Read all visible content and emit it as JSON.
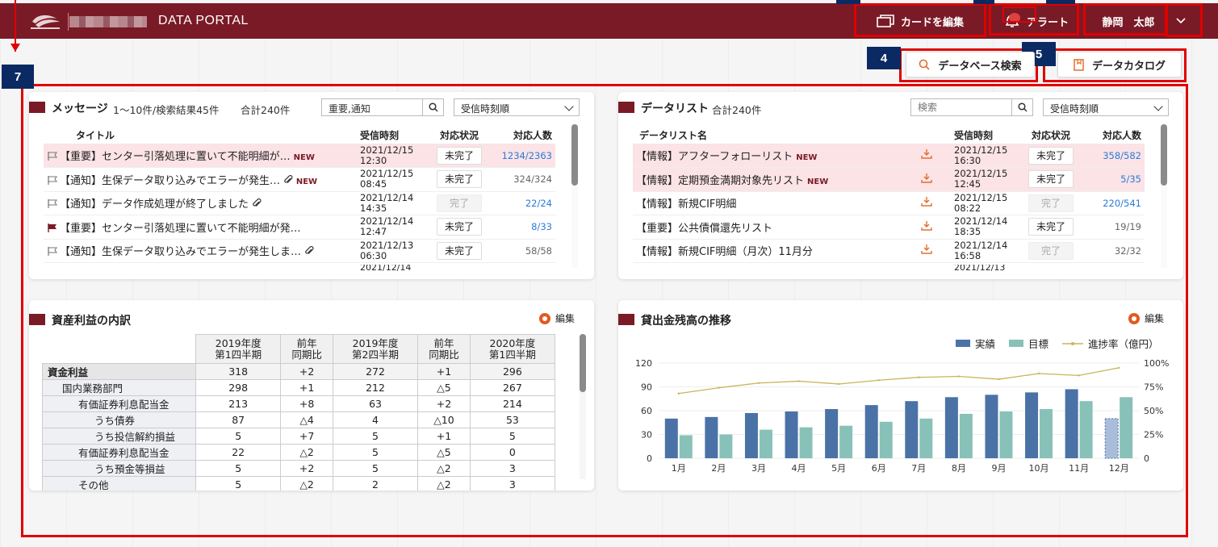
{
  "app": {
    "title": "DATA PORTAL"
  },
  "header": {
    "edit_cards_label": "カードを編集",
    "alert_label": "アラート",
    "user_name": "静岡　太郎"
  },
  "annotations": {
    "a4": "4",
    "a5": "5",
    "a7": "7"
  },
  "actions": {
    "db_search_label": "データベース検索",
    "data_catalog_label": "データカタログ"
  },
  "messages": {
    "title": "メッセージ",
    "summary": "1～10件/検索結果45件",
    "total": "合計240件",
    "search_value": "重要,通知",
    "sort_label": "受信時刻順",
    "columns": [
      "タイトル",
      "受信時刻",
      "対応状況",
      "対応人数"
    ],
    "rows": [
      {
        "flag": "outline",
        "title": "【重要】センター引落処理に置いて不能明細が…",
        "attach": false,
        "new": "NEW",
        "date": "2021/12/15",
        "time": "12:30",
        "status": "未完了",
        "done": false,
        "count": "1234/2363",
        "blue": true,
        "hl": true
      },
      {
        "flag": "outline",
        "title": "【通知】生保データ取り込みでエラーが発生…",
        "attach": true,
        "new": "NEW",
        "date": "2021/12/15",
        "time": "08:45",
        "status": "未完了",
        "done": false,
        "count": "324/324",
        "blue": false,
        "hl": false
      },
      {
        "flag": "outline",
        "title": "【通知】データ作成処理が終了しました",
        "attach": true,
        "new": "",
        "date": "2021/12/14",
        "time": "14:35",
        "status": "完了",
        "done": true,
        "count": "22/24",
        "blue": true,
        "hl": false
      },
      {
        "flag": "filled",
        "title": "【重要】センター引落処理に置いて不能明細が発…",
        "attach": false,
        "new": "",
        "date": "2021/12/14",
        "time": "12:47",
        "status": "未完了",
        "done": false,
        "count": "8/33",
        "blue": true,
        "hl": false
      },
      {
        "flag": "outline",
        "title": "【通知】生保データ取り込みでエラーが発生しま…",
        "attach": true,
        "new": "",
        "date": "2021/12/13",
        "time": "06:30",
        "status": "未完了",
        "done": false,
        "count": "58/58",
        "blue": false,
        "hl": false
      }
    ],
    "partial_date": "2021/12/14"
  },
  "datalist": {
    "title": "データリスト",
    "total": "合計240件",
    "search_placeholder": "検索",
    "sort_label": "受信時刻順",
    "columns": [
      "データリスト名",
      "受信時刻",
      "対応状況",
      "対応人数"
    ],
    "rows": [
      {
        "name": "【情報】アフターフォローリスト",
        "new": "NEW",
        "date": "2021/12/15",
        "time": "16:30",
        "status": "未完了",
        "done": false,
        "count": "358/582",
        "blue": true,
        "hl": true
      },
      {
        "name": "【情報】定期預金満期対象先リスト",
        "new": "NEW",
        "date": "2021/12/15",
        "time": "12:45",
        "status": "未完了",
        "done": false,
        "count": "5/35",
        "blue": true,
        "hl": true
      },
      {
        "name": "【情報】新規CIF明細",
        "new": "",
        "date": "2021/12/15",
        "time": "08:22",
        "status": "完了",
        "done": true,
        "count": "220/541",
        "blue": true,
        "hl": false
      },
      {
        "name": "【重要】公共債償還先リスト",
        "new": "",
        "date": "2021/12/14",
        "time": "18:35",
        "status": "未完了",
        "done": false,
        "count": "19/19",
        "blue": false,
        "hl": false
      },
      {
        "name": "【情報】新規CIF明細（月次）11月分",
        "new": "",
        "date": "2021/12/14",
        "time": "16:58",
        "status": "完了",
        "done": true,
        "count": "32/32",
        "blue": false,
        "hl": false
      }
    ],
    "partial_date": "2021/12/13"
  },
  "assets": {
    "title": "資産利益の内訳",
    "edit_label": "編集",
    "columns": [
      {
        "l1": "2019年度",
        "l2": "第1四半期"
      },
      {
        "l1": "前年",
        "l2": "同期比"
      },
      {
        "l1": "2019年度",
        "l2": "第2四半期"
      },
      {
        "l1": "前年",
        "l2": "同期比"
      },
      {
        "l1": "2020年度",
        "l2": "第1四半期"
      }
    ],
    "rows": [
      {
        "level": 0,
        "label": "資金利益",
        "values": [
          "318",
          "+2",
          "272",
          "+1",
          "296"
        ]
      },
      {
        "level": 1,
        "label": "国内業務部門",
        "values": [
          "298",
          "+1",
          "212",
          "△5",
          "267"
        ]
      },
      {
        "level": 2,
        "label": "有価証券利息配当金",
        "values": [
          "213",
          "+8",
          "63",
          "+2",
          "214"
        ]
      },
      {
        "level": 3,
        "label": "うち債券",
        "values": [
          "87",
          "△4",
          "4",
          "△10",
          "53"
        ]
      },
      {
        "level": 3,
        "label": "うち投信解約損益",
        "values": [
          "5",
          "+7",
          "5",
          "+1",
          "5"
        ]
      },
      {
        "level": 2,
        "label": "有価証券利息配当金",
        "values": [
          "22",
          "△2",
          "5",
          "△5",
          "0"
        ]
      },
      {
        "level": 3,
        "label": "うち預金等損益",
        "values": [
          "5",
          "+2",
          "5",
          "△2",
          "3"
        ]
      },
      {
        "level": 2,
        "label": "その他",
        "values": [
          "5",
          "△2",
          "2",
          "△2",
          "3"
        ]
      }
    ]
  },
  "loans": {
    "title": "貸出金残高の推移",
    "edit_label": "編集",
    "colors": {
      "actual": "#4a72a6",
      "target": "#88c1b8",
      "rate": "#c9b45a",
      "projected": "#a9bddb"
    }
  },
  "chart_data": {
    "type": "bar",
    "categories": [
      "1月",
      "2月",
      "3月",
      "4月",
      "5月",
      "6月",
      "7月",
      "8月",
      "9月",
      "10月",
      "11月",
      "12月"
    ],
    "series": [
      {
        "name": "実績",
        "values": [
          50,
          52,
          57,
          59,
          62,
          67,
          72,
          77,
          80,
          83,
          87,
          50
        ],
        "projected_last": true
      },
      {
        "name": "目標",
        "values": [
          29,
          30,
          36,
          39,
          41,
          46,
          50,
          56,
          59,
          62,
          72,
          77
        ]
      },
      {
        "name": "進捗率（億円）",
        "axis": "right",
        "values": [
          68,
          74,
          79,
          81,
          78,
          82,
          85,
          86,
          83,
          89,
          87,
          95
        ]
      }
    ],
    "y_left": {
      "ticks": [
        "0",
        "30",
        "60",
        "90",
        "120"
      ],
      "ylim": [
        0,
        120
      ]
    },
    "y_right": {
      "ticks": [
        "0",
        "25%",
        "50%",
        "75%",
        "100%"
      ],
      "ylim": [
        0,
        100
      ]
    },
    "legend": "top-right",
    "grid": true
  }
}
